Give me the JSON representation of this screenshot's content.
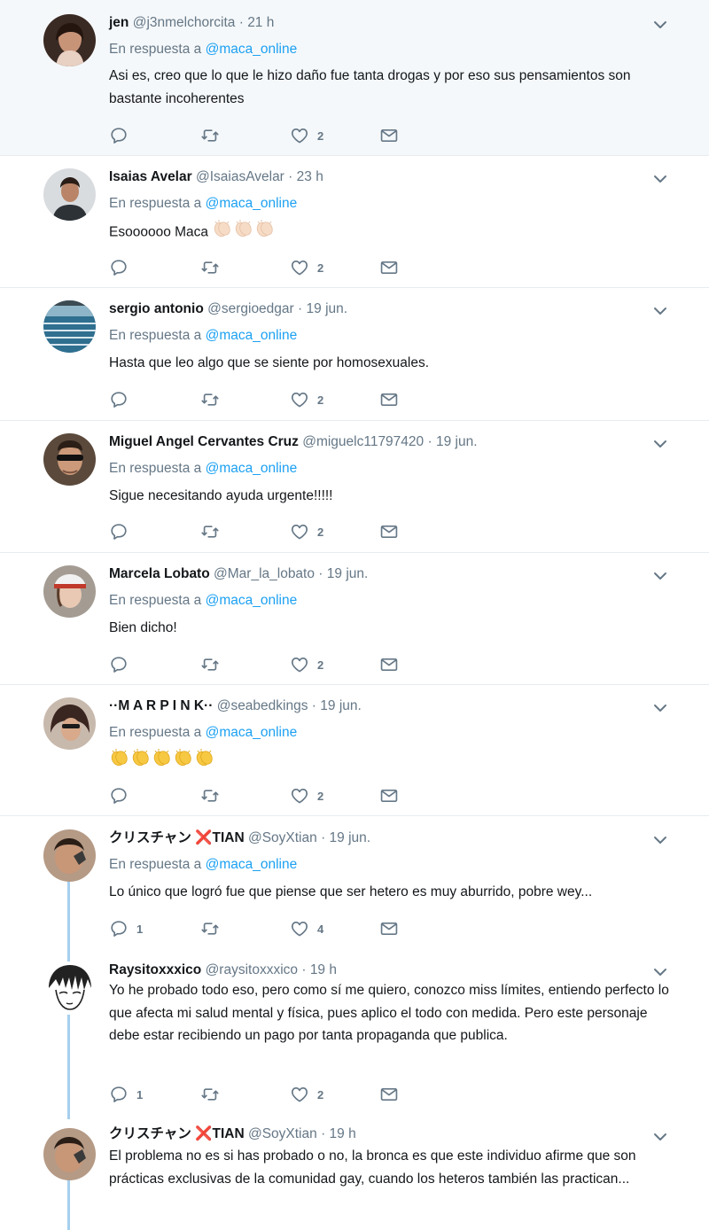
{
  "colors": {
    "accent": "#1da1f2",
    "muted": "#657786",
    "thread_line": "#a7cfee",
    "highlight_bg": "#f5f8fa"
  },
  "icons": {
    "reply": "reply-icon",
    "retweet": "retweet-icon",
    "like": "heart-icon",
    "message": "envelope-icon",
    "more": "chevron-down-icon"
  },
  "tweets": [
    {
      "name": "jen",
      "handle": "@j3nmelchorcita",
      "sep": "·",
      "time": "21 h",
      "reply_prefix": "En respuesta a",
      "reply_to": "@maca_online",
      "text": "Asi es, creo que lo que le hizo daño fue tanta drogas y por eso sus pensamientos son bastante incoherentes",
      "replies": "",
      "retweets": "",
      "likes": "2"
    },
    {
      "name": "Isaias Avelar",
      "handle": "@IsaiasAvelar",
      "sep": "·",
      "time": "23 h",
      "reply_prefix": "En respuesta a",
      "reply_to": "@maca_online",
      "text": "Esoooooo Maca",
      "emoji": "clapping-hands-emoji x3",
      "replies": "",
      "retweets": "",
      "likes": "2"
    },
    {
      "name": "sergio antonio",
      "handle": "@sergioedgar",
      "sep": "·",
      "time": "19 jun.",
      "reply_prefix": "En respuesta a",
      "reply_to": "@maca_online",
      "text": "Hasta que leo algo que se siente por homosexuales.",
      "replies": "",
      "retweets": "",
      "likes": "2"
    },
    {
      "name": "Miguel Angel Cervantes Cruz",
      "handle": "@miguelc11797420",
      "sep": "·",
      "time": "19 jun.",
      "reply_prefix": "En respuesta a",
      "reply_to": "@maca_online",
      "text": "Sigue necesitando ayuda urgente!!!!!",
      "replies": "",
      "retweets": "",
      "likes": "2"
    },
    {
      "name": "Marcela Lobato",
      "handle": "@Mar_la_lobato",
      "sep": "·",
      "time": "19 jun.",
      "reply_prefix": "En respuesta a",
      "reply_to": "@maca_online",
      "text": "Bien dicho!",
      "replies": "",
      "retweets": "",
      "likes": "2"
    },
    {
      "name": "··M A R P I N K··",
      "handle": "@seabedkings",
      "sep": "·",
      "time": "19 jun.",
      "reply_prefix": "En respuesta a",
      "reply_to": "@maca_online",
      "text": "",
      "emoji": "clapping-hands-emoji x5",
      "replies": "",
      "retweets": "",
      "likes": "2"
    },
    {
      "name_a": "クリスチャン",
      "name_x": "❌",
      "name_b": "TIAN",
      "handle": "@SoyXtian",
      "sep": "·",
      "time": "19 jun.",
      "reply_prefix": "En respuesta a",
      "reply_to": "@maca_online",
      "text": "Lo único que logró fue que piense que ser hetero es muy aburrido, pobre wey...",
      "replies": "1",
      "retweets": "",
      "likes": "4"
    },
    {
      "name": "Raysitoxxxico",
      "handle": "@raysitoxxxico",
      "sep": "·",
      "time": "19 h",
      "text": "Yo he probado todo eso, pero como sí me quiero, conozco miss límites, entiendo perfecto lo que afecta mi salud mental y física, pues aplico el todo con medida. Pero este personaje debe estar recibiendo un pago por tanta propaganda que publica.",
      "replies": "1",
      "retweets": "",
      "likes": "2"
    },
    {
      "name_a": "クリスチャン",
      "name_x": "❌",
      "name_b": "TIAN",
      "handle": "@SoyXtian",
      "sep": "·",
      "time": "19 h",
      "text": "El problema no es si has probado o no, la bronca es que este individuo afirme que son prácticas exclusivas de la comunidad gay, cuando los heteros también las practican..."
    }
  ]
}
